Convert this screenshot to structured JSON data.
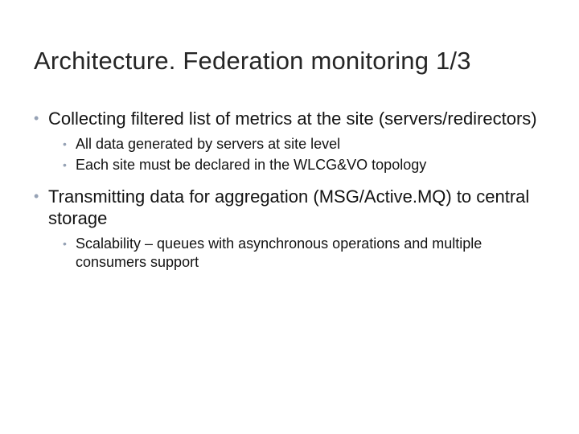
{
  "title": "Architecture. Federation monitoring 1/3",
  "bullets": [
    {
      "text": "Collecting filtered list of metrics at the site (servers/redirectors)",
      "sub": [
        "All data generated by servers at site level",
        "Each site must be declared in the WLCG&VO topology"
      ]
    },
    {
      "text": "Transmitting data for aggregation (MSG/Active.MQ) to central storage",
      "sub": [
        "Scalability – queues with asynchronous operations and multiple consumers support"
      ]
    }
  ]
}
